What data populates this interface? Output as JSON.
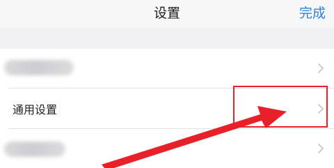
{
  "header": {
    "title": "设置",
    "done_label": "完成"
  },
  "settings": {
    "items": [
      {
        "label": ""
      },
      {
        "label": "通用设置"
      },
      {
        "label": ""
      }
    ]
  },
  "annotation": {
    "highlight_color": "#e8202a",
    "arrow_color": "#e8202a"
  },
  "colors": {
    "accent": "#2a84d8"
  },
  "icons": {
    "row_chevron": "chevron-right-icon"
  }
}
